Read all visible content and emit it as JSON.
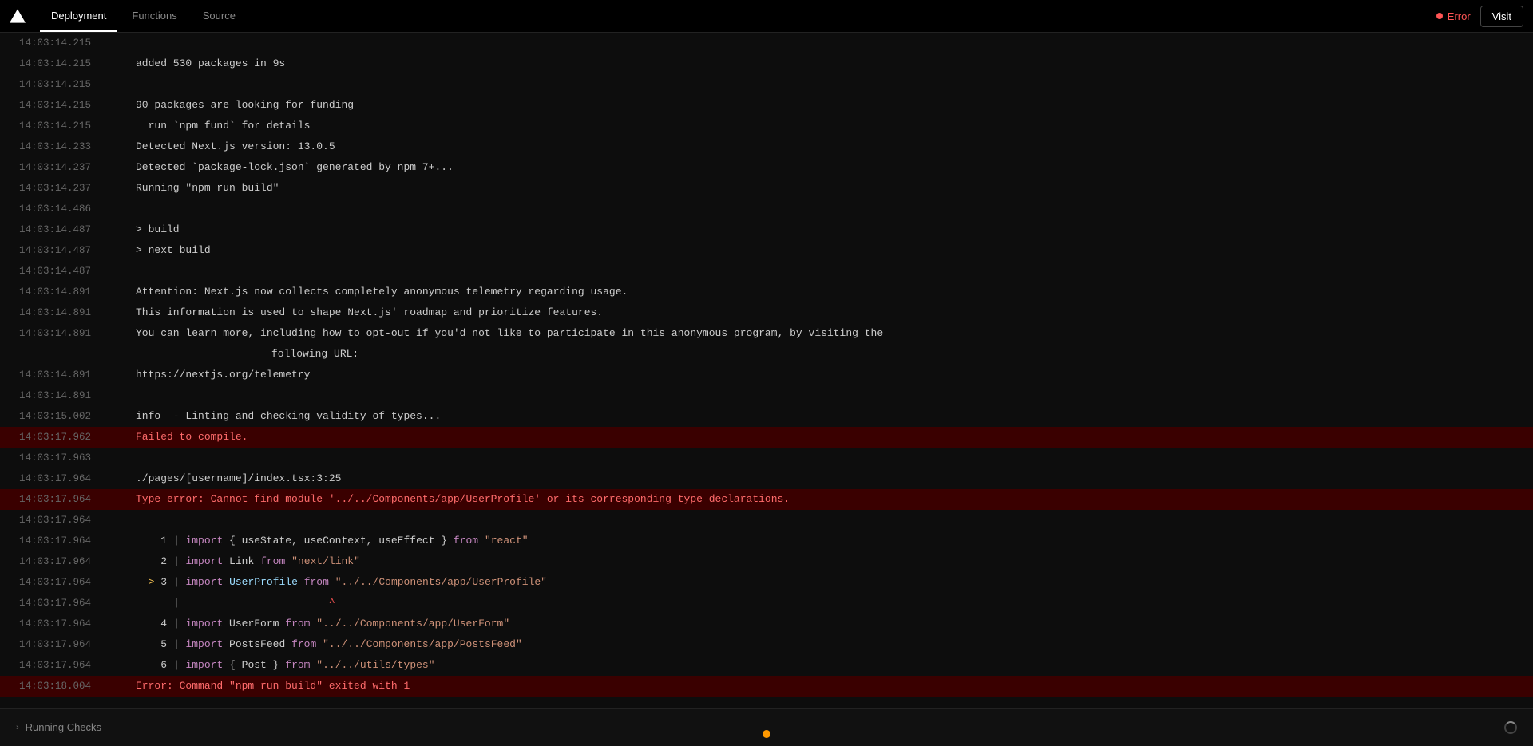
{
  "navbar": {
    "logo_alt": "Vercel logo",
    "tabs": [
      {
        "id": "deployment",
        "label": "Deployment",
        "active": true
      },
      {
        "id": "functions",
        "label": "Functions",
        "active": false
      },
      {
        "id": "source",
        "label": "Source",
        "active": false
      }
    ],
    "error_label": "Error",
    "visit_label": "Visit"
  },
  "logs": [
    {
      "timestamp": "14:03:14.215",
      "text": "",
      "type": "normal"
    },
    {
      "timestamp": "14:03:14.215",
      "text": "added 530 packages in 9s",
      "type": "normal"
    },
    {
      "timestamp": "14:03:14.215",
      "text": "",
      "type": "normal"
    },
    {
      "timestamp": "14:03:14.215",
      "text": "90 packages are looking for funding",
      "type": "normal"
    },
    {
      "timestamp": "14:03:14.215",
      "text": "  run `npm fund` for details",
      "type": "normal"
    },
    {
      "timestamp": "14:03:14.233",
      "text": "Detected Next.js version: 13.0.5",
      "type": "normal"
    },
    {
      "timestamp": "14:03:14.237",
      "text": "Detected `package-lock.json` generated by npm 7+...",
      "type": "normal"
    },
    {
      "timestamp": "14:03:14.237",
      "text": "Running \"npm run build\"",
      "type": "normal"
    },
    {
      "timestamp": "14:03:14.486",
      "text": "",
      "type": "normal"
    },
    {
      "timestamp": "14:03:14.487",
      "text": "> build",
      "type": "normal"
    },
    {
      "timestamp": "14:03:14.487",
      "text": "> next build",
      "type": "normal"
    },
    {
      "timestamp": "14:03:14.487",
      "text": "",
      "type": "normal"
    },
    {
      "timestamp": "14:03:14.891",
      "text": "Attention: Next.js now collects completely anonymous telemetry regarding usage.",
      "type": "normal"
    },
    {
      "timestamp": "14:03:14.891",
      "text": "This information is used to shape Next.js' roadmap and prioritize features.",
      "type": "normal"
    },
    {
      "timestamp": "14:03:14.891",
      "text": "You can learn more, including how to opt-out if you'd not like to participate in this anonymous program, by visiting the",
      "type": "normal"
    },
    {
      "timestamp": "",
      "text": "following URL:",
      "type": "normal",
      "indent": true
    },
    {
      "timestamp": "14:03:14.891",
      "text": "https://nextjs.org/telemetry",
      "type": "normal"
    },
    {
      "timestamp": "14:03:14.891",
      "text": "",
      "type": "normal"
    },
    {
      "timestamp": "14:03:15.002",
      "text": "info  - Linting and checking validity of types...",
      "type": "normal"
    },
    {
      "timestamp": "14:03:17.962",
      "text": "Failed to compile.",
      "type": "error"
    },
    {
      "timestamp": "14:03:17.963",
      "text": "",
      "type": "normal"
    },
    {
      "timestamp": "14:03:17.964",
      "text": "./pages/[username]/index.tsx:3:25",
      "type": "normal"
    },
    {
      "timestamp": "14:03:17.964",
      "text": "Type error: Cannot find module '../../Components/app/UserProfile' or its corresponding type declarations.",
      "type": "error"
    },
    {
      "timestamp": "14:03:17.964",
      "text": "",
      "type": "normal"
    },
    {
      "timestamp": "14:03:17.964",
      "text_html": "    1 | <span class='import-kw'>import</span> { useState, useContext, useEffect } <span class='import-kw'>from</span> <span class='from-str'>\"react\"</span>",
      "type": "code"
    },
    {
      "timestamp": "14:03:17.964",
      "text_html": "    2 | <span class='import-kw'>import</span> Link <span class='import-kw'>from</span> <span class='from-str'>\"next/link\"</span>",
      "type": "code"
    },
    {
      "timestamp": "14:03:17.964",
      "text_html": "  <span class='arrow'>&gt;</span> 3 | <span class='import-kw'>import</span> <span class='cyan'>UserProfile</span> <span class='import-kw'>from</span> <span class='from-str'>\"../../Components/app/UserProfile\"</span>",
      "type": "code"
    },
    {
      "timestamp": "14:03:17.964",
      "text_html": "      |                        <span class='caret-line'>^</span>",
      "type": "code"
    },
    {
      "timestamp": "14:03:17.964",
      "text_html": "    4 | <span class='import-kw'>import</span> UserForm <span class='import-kw'>from</span> <span class='from-str'>\"../../Components/app/UserForm\"</span>",
      "type": "code"
    },
    {
      "timestamp": "14:03:17.964",
      "text_html": "    5 | <span class='import-kw'>import</span> PostsFeed <span class='import-kw'>from</span> <span class='from-str'>\"../../Components/app/PostsFeed\"</span>",
      "type": "code"
    },
    {
      "timestamp": "14:03:17.964",
      "text_html": "    6 | <span class='import-kw'>import</span> { Post } <span class='import-kw'>from</span> <span class='from-str'>\"../../utils/types\"</span>",
      "type": "code"
    },
    {
      "timestamp": "14:03:18.004",
      "text": "Error: Command \"npm run build\" exited with 1",
      "type": "error"
    }
  ],
  "bottom": {
    "running_checks_label": "Running Checks",
    "chevron": "›"
  }
}
